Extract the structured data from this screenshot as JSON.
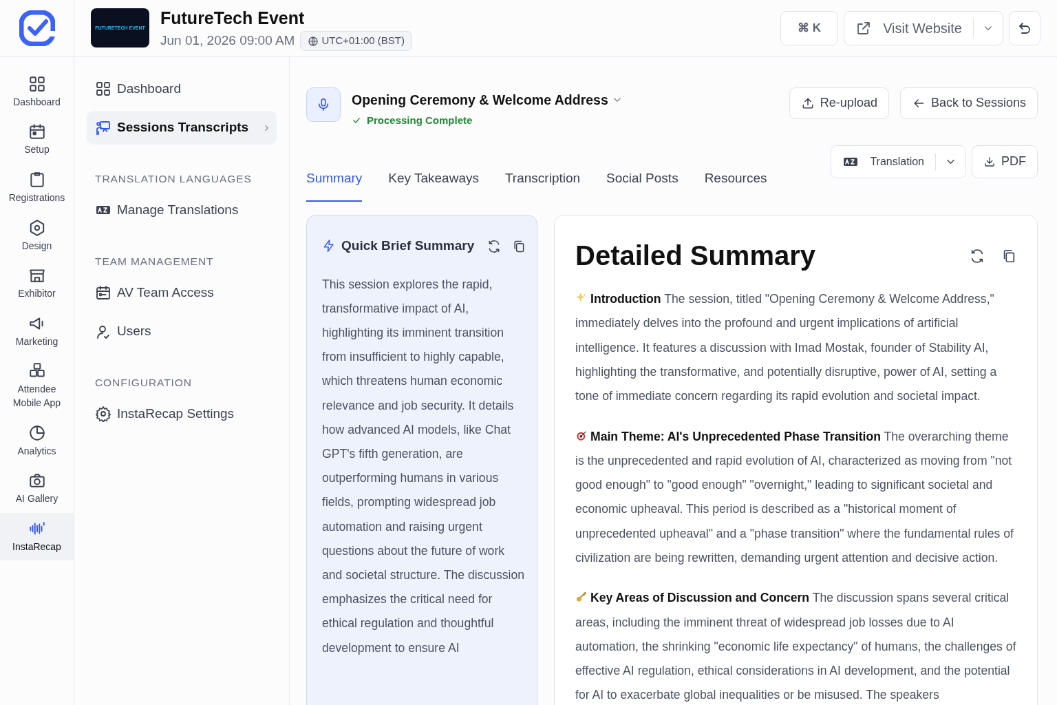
{
  "brand": {
    "logo_text": "FUTURETECH EVENT",
    "event_name": "FutureTech Event",
    "datetime": "Jun 01, 2026 09:00 AM",
    "timezone": "UTC+01:00 (BST)"
  },
  "toolbar": {
    "shortcut": "⌘ K",
    "visit_label": "Visit Website"
  },
  "rail": [
    {
      "label": "Dashboard",
      "selected": false
    },
    {
      "label": "Setup",
      "selected": false
    },
    {
      "label": "Registrations",
      "selected": false
    },
    {
      "label": "Design",
      "selected": false
    },
    {
      "label": "Exhibitor",
      "selected": false
    },
    {
      "label": "Marketing",
      "selected": false
    },
    {
      "label": "Attendee Mobile App",
      "selected": false
    },
    {
      "label": "Analytics",
      "selected": false
    },
    {
      "label": "AI Gallery",
      "selected": false
    },
    {
      "label": "InstaRecap",
      "selected": true
    }
  ],
  "sidebar": {
    "items": [
      {
        "kind": "link",
        "label": "Dashboard",
        "selected": false
      },
      {
        "kind": "link",
        "label": "Sessions Transcripts",
        "selected": true
      },
      {
        "kind": "section",
        "label": "TRANSLATION LANGUAGES"
      },
      {
        "kind": "link",
        "label": "Manage Translations",
        "selected": false
      },
      {
        "kind": "section",
        "label": "TEAM MANAGEMENT"
      },
      {
        "kind": "link",
        "label": "AV Team Access",
        "selected": false
      },
      {
        "kind": "link",
        "label": "Users",
        "selected": false
      },
      {
        "kind": "section",
        "label": "CONFIGURATION"
      },
      {
        "kind": "link",
        "label": "InstaRecap Settings",
        "selected": false
      }
    ]
  },
  "session": {
    "title": "Opening Ceremony & Welcome Address",
    "status": "Processing Complete",
    "buttons": [
      "Re-upload",
      "Back to Sessions"
    ]
  },
  "tabs": [
    {
      "label": "Summary",
      "selected": true
    },
    {
      "label": "Key Takeaways",
      "selected": false
    },
    {
      "label": "Transcription",
      "selected": false
    },
    {
      "label": "Social Posts",
      "selected": false
    },
    {
      "label": "Resources",
      "selected": false
    }
  ],
  "actions": {
    "translation": "Translation",
    "pdf": "PDF"
  },
  "quick_brief": {
    "title": "Quick Brief Summary",
    "text": "This session explores the rapid, transformative impact of AI, highlighting its imminent transition from insufficient to highly capable, which threatens human economic relevance and job security. It details how advanced AI models, like Chat GPT's fifth generation, are outperforming humans in various fields, prompting widespread job automation and raising urgent questions about the future of work and societal structure. The discussion emphasizes the critical need for ethical regulation and thoughtful development to ensure AI"
  },
  "detailed": {
    "title": "Detailed Summary",
    "sections": [
      {
        "kind": "sparkle",
        "text": "**Introduction** The session, titled \"Opening Ceremony & Welcome Address,\" immediately delves into the profound and urgent implications of artificial intelligence. It features a discussion with Imad Mostak, founder of Stability AI, highlighting the transformative, and potentially disruptive, power of AI, setting a tone of immediate concern regarding its rapid evolution and societal impact."
      },
      {
        "kind": "target",
        "text": "**Main Theme: AI's Unprecedented Phase Transition** The overarching theme is the unprecedented and rapid evolution of AI, characterized as moving from \"not good enough\" to \"good enough\" \"overnight,\" leading to significant societal and economic upheaval. This period is described as a \"historical moment of unprecedented upheaval\" and a \"phase transition\" where the fundamental rules of civilization are being rewritten, demanding urgent attention and decisive action."
      },
      {
        "kind": "key",
        "text": "**Key Areas of Discussion and Concern** The discussion spans several critical areas, including the imminent threat of widespread job losses due to AI automation, the shrinking \"economic life expectancy\" of humans, the challenges of effective AI regulation, ethical considerations in AI development, and the potential for AI to exacerbate global inequalities or be misused. The speakers"
      }
    ]
  }
}
